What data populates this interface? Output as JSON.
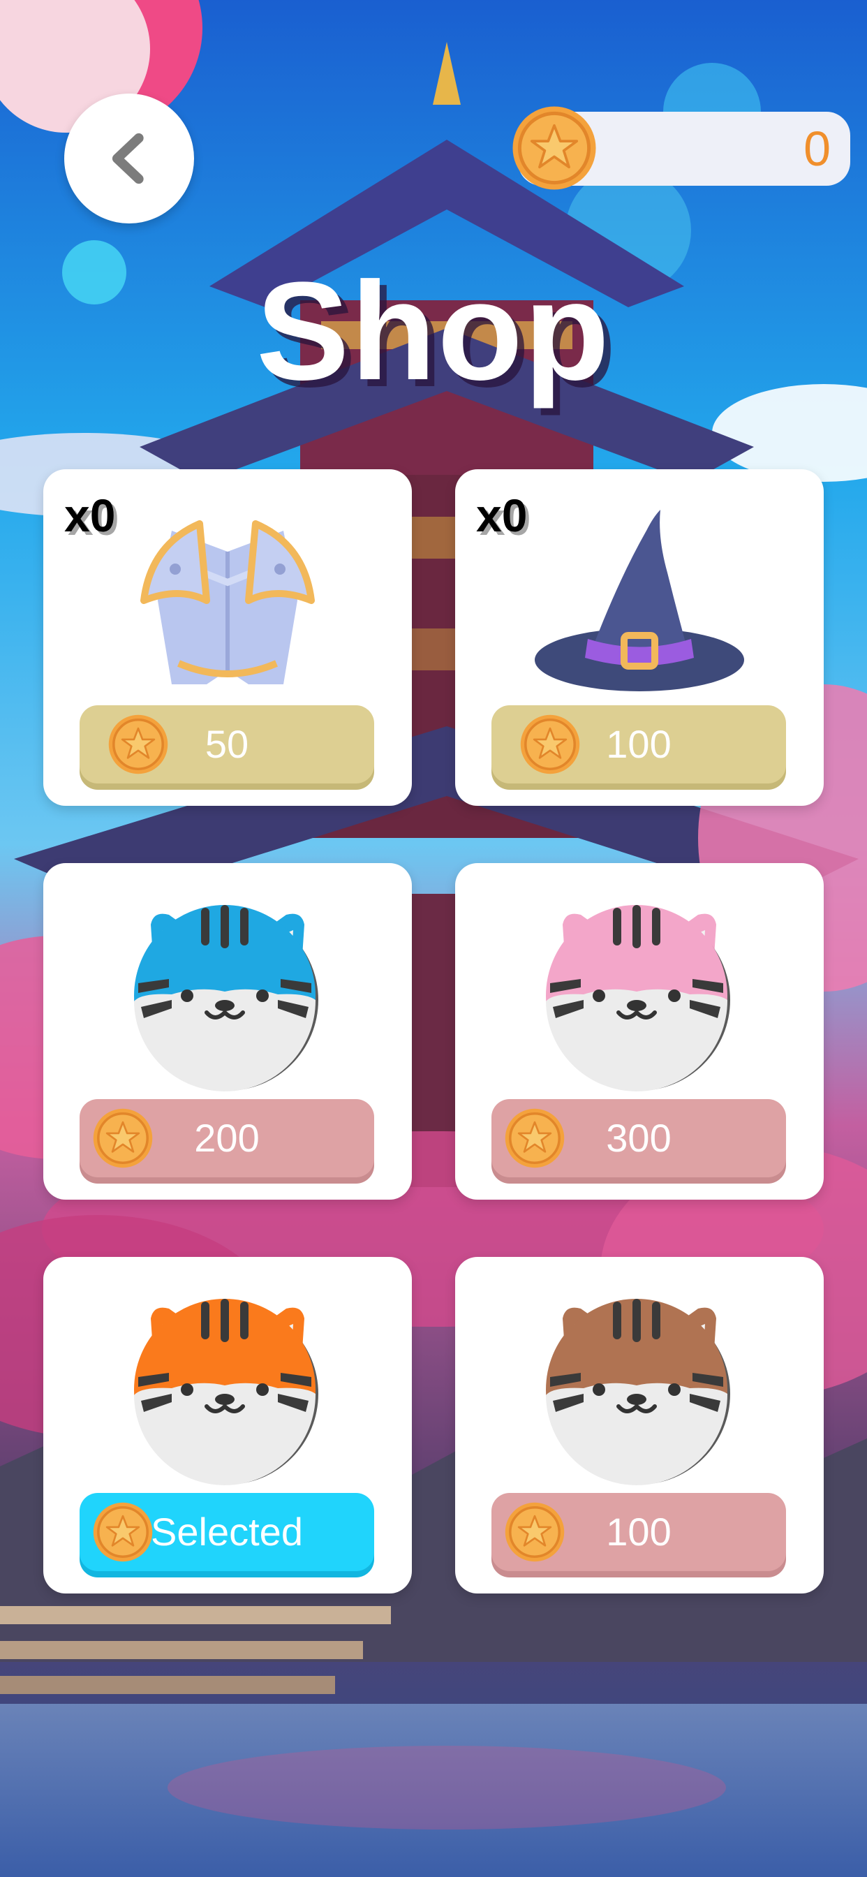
{
  "screen_title": "Shop",
  "icons": {
    "back": "chevron-left-icon",
    "coin": "coin-star-icon"
  },
  "colors": {
    "coin_count": "#f08f2c",
    "button_gold": "#ddcf92",
    "button_rose": "#dea2a4",
    "button_selected": "#20d4fc"
  },
  "coins": {
    "balance": "0"
  },
  "items": [
    {
      "name": "armor",
      "qty": "x0",
      "price": "50",
      "style": "gold"
    },
    {
      "name": "wizard-hat",
      "qty": "x0",
      "price": "100",
      "style": "gold"
    },
    {
      "name": "blue-tiger-skin",
      "price": "200",
      "style": "rose"
    },
    {
      "name": "pink-tiger-skin",
      "price": "300",
      "style": "rose"
    },
    {
      "name": "orange-tiger-skin",
      "price": "Selected",
      "style": "blue"
    },
    {
      "name": "brown-tiger-skin",
      "price": "100",
      "style": "rose"
    }
  ]
}
